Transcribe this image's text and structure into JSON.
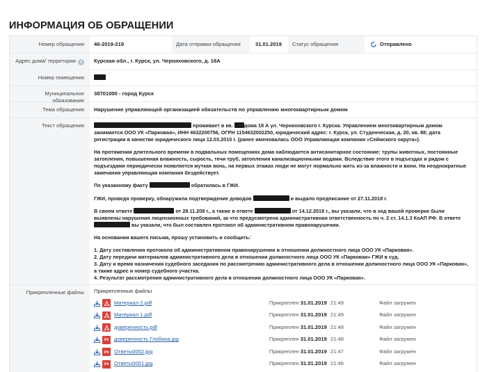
{
  "page_title": "ИНФОРМАЦИЯ ОБ ОБРАЩЕНИИ",
  "header": {
    "number_label": "Номер обращения",
    "number_value": "46-2019-219",
    "date_label": "Дата отправки обращения",
    "date_value": "31.01.2019",
    "status_label": "Статус обращения",
    "status_value": "Отправлено"
  },
  "address": {
    "label": "Адрес дома/ территории",
    "value": "Курская обл., г. Курск, ул. Черняховского, д. 18А"
  },
  "room": {
    "label": "Номер помещения"
  },
  "municipality": {
    "label": "Муниципальное образование",
    "value": "38701000 - город Курск"
  },
  "topic": {
    "label": "Тема обращения",
    "value": "Нарушение управляющей организацией обязательств по управлению многоквартирным домом"
  },
  "text": {
    "label": "Текст обращения",
    "p1_a": "проживает в кв.",
    "p1_b": "дома 18 А ул. Черняховского г. Курска. Управлением многоквартирным домом занимается ООО УК «Парковая», ИНН 4632200756, ОГРН 1154632002250, юридический адрес: г. Курск, ул. Студенческая, д. 20, кв. 88; дата регистрации в качестве юридического лица 12.03.2015 г. (ранее именовалась ООО Управляющая компания «Сеймского округа»).",
    "p2": "На протяжении длительного времени в подвальных помещениях дома наблюдается антисанитарное состояние: трупы животных, постоянные затопления, повышенная влажность, сырость, течи труб, затопления канализационными водами. Вследствие этого в подъездах и рядом с подъездами периодически появляется жуткая вонь, на первых этажах люди не могут нормально жить из-за влажности и вони. На неоднократные замечания управляющая компания бездействует.",
    "p3_a": "По указанному факту",
    "p3_b": "обратилась в ГЖИ.",
    "p4_a": "ГЖИ, проведя проверку, обнаружила подтверждение доводов",
    "p4_b": "и выдало предписание от 27.11.2018 г.",
    "p5_a": "В своем ответе",
    "p5_b": "от 28.11.208 г., а также в ответе",
    "p5_c": "от 14.12.2018 г., вы указали, что в ход вашей проверки были выявлены нарушения лицензионных требований, за что предусмотрена административная ответственность по ч. 2 ст. 14.1.3 КоАП РФ. В ответе",
    "p5_d": "вы указали, что был составлен протокол об административном правонарушении.",
    "p6": "На основании вашего письма, прошу установить и сообщить:",
    "items": [
      "1.    Дату составления протокола об административном правонарушении в отношении должностного лица ООО УК «Парковая».",
      "2.    Дату передачи материалов административного дела в отношении должностного лица ООО УК «Парковая» ГЖИ в суд.",
      "3.    Дату и время назначения судебного заседания по рассмотрению административного дела в отношении должностного лица ООО УК «Парковая», а также адрес и номер судебного участка.",
      "4.    Результат рассмотрения административного дела в отношении должностного лица ООО УК «Парковая»."
    ]
  },
  "files": {
    "label": "Прикрепленные файлы",
    "head": "Прикрепленные файлы",
    "attached_word": "Прикреплен",
    "list": [
      {
        "name": "Материал 2.pdf",
        "type": "pdf",
        "date": "31.01.2019",
        "time": "21:49",
        "status": "Файл загружен"
      },
      {
        "name": "Материал 1.pdf",
        "type": "pdf",
        "date": "31.01.2019",
        "time": "21:49",
        "status": "Файл загружен"
      },
      {
        "name": "доверенность.pdf",
        "type": "pdf",
        "date": "31.01.2019",
        "time": "21:48",
        "status": "Файл загружен"
      },
      {
        "name": "доверенность Глобина.jpg",
        "type": "jpg",
        "date": "31.01.2019",
        "time": "21:48",
        "status": "Файл загружен"
      },
      {
        "name": "Ответы0002.jpg",
        "type": "jpg",
        "date": "31.01.2019",
        "time": "21:47",
        "status": "Файл загружен"
      },
      {
        "name": "Ответы0001.jpg",
        "type": "jpg",
        "date": "31.01.2019",
        "time": "21:46",
        "status": "Файл загружен"
      }
    ]
  },
  "colors": {
    "label_bg": "#f3f5f7",
    "link": "#2760a8",
    "file_icon": "#d8413a",
    "status_icon": "#2b6fb6"
  },
  "icons": {
    "status": "refresh-icon",
    "info": "info-icon",
    "download": "download-icon",
    "pdf": "pdf-file-icon",
    "jpg": "jpg-file-icon"
  }
}
